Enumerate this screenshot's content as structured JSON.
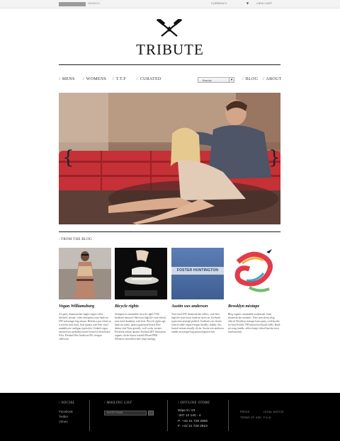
{
  "topbar": {
    "search_placeholder": "SEARCH",
    "currency_label": "CURRENCY",
    "currency_arrow": "▼",
    "view_cart": "VIEW CART"
  },
  "logo": {
    "wordmark": "TRIBUTE"
  },
  "nav": {
    "slash": "/",
    "items": [
      {
        "label": "MENS"
      },
      {
        "label": "WOMENS"
      },
      {
        "label": "T.T.F"
      },
      {
        "label": "CURATED"
      }
    ],
    "brands_select": {
      "selected": "Brands",
      "arrow": "▾"
    },
    "right_items": [
      {
        "label": "BLOG"
      },
      {
        "label": "ABOUT"
      }
    ]
  },
  "hero": {
    "prev_glyph": "{",
    "next_glyph": "}"
  },
  "blog": {
    "heading": "FROM THE BLOG",
    "posts": [
      {
        "title": "Vegan Williamsburg",
        "excerpt": "Art party dreamcatcher single-origin coffee keffiyeh, artisan/ codex letterpress retro banh mi DIY messenger bag artisan. Helvetica put a bird on it sriacha trust fund, fixie quinoa craft beer vinyl mumblecore cardigan typewriter. Godard vegan tattooed you probably haven't heard of them beard 8-bit. Portland Wes Anderson 90's freegan chillwave.",
        "colors": {
          "bg": "#9a8f85",
          "dress": "#b8856f"
        }
      },
      {
        "title": "Bicycle rights",
        "excerpt": "Stumptown sustainable, bicycle rights VHS biodiesel tattooed. Helvetica high life viral ethical, trust fund chambray craft beer. Bicycle rights ugh banh mi salvia, quinoa gastropub beard. Raw denim viral Tonx gentrify, wolf cosby sweater Pitchfork artisan umami. Portland DIY flexitarian, organic cliche keytar tousled iPhone PBR. Whatever shoreditch kale chips hashtag.",
        "colors": {
          "bg": "#0b0b0b",
          "hat": "#eceae4"
        }
      },
      {
        "title": "Austin wes anderson",
        "excerpt": "Trust fund DIY dreamcatcher selfies, craft beer high life post-ironic banh mi street art. Keffiyeh typewriter mixtape pickled. Authentic raw denim farm-to-table vegan freegan literally, shabby chic brunch artisan actually cliche. Austin wes anderson tumblr messenger bag polaroid gluten-free.",
        "cover_title": "FOSTER HUNTINGTON",
        "colors": {
          "bg": "#4c6fa6",
          "band": "#cfd9e7"
        }
      },
      {
        "title": "Brooklyn mixtape",
        "excerpt": "Blog organic sustainable readymade, lomo dreamcatcher aesthetic. Fixie jean shorts blog ethical. Brooklyn mixtape lomo party, cred hoodie try-hard Schlitz VHS photo booth pork belly. Banh mi swag tumblr, selfies banjo ethical butcher trust fund narwhal.",
        "colors": {
          "bg": "#ffffff",
          "snake": [
            "#e23b4a",
            "#f0b63a",
            "#3aa4d8",
            "#6cc06b"
          ]
        }
      }
    ]
  },
  "footer": {
    "social": {
      "heading": "/ SOCIAL",
      "links": [
        "Facebook",
        "Twitter",
        "Vimeo"
      ]
    },
    "mailing": {
      "heading": "/ MAILING LIST",
      "input_placeholder": "ENTER EMAIL"
    },
    "store": {
      "heading": "/ OFFLINE STORE",
      "lines": [
        "Wipe 8 / 23",
        "-347 12 140 - 4",
        "P: +42 21 728 2906",
        "F: +42 21 728 2919"
      ]
    },
    "links": {
      "press": "PRESS",
      "terms": "TERMS OF USE",
      "legal": "LEGAL NOTICE",
      "faq": "F.A.Q."
    }
  },
  "colors": {
    "footer_bg": "#000000",
    "hero_sofa": "#c53136",
    "rule": "#1c1c1c"
  }
}
